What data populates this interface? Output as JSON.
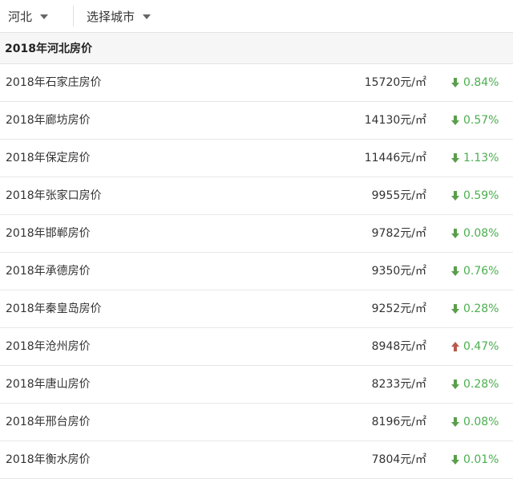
{
  "filters": {
    "province": "河北",
    "city_placeholder": "选择城市"
  },
  "section": {
    "title": "2018年河北房价"
  },
  "colors": {
    "down_arrow": "#5a9e4b",
    "up_arrow": "#b85a4a",
    "change_text": "#4caf50"
  },
  "rows": [
    {
      "name": "2018年石家庄房价",
      "price": "15720元/㎡",
      "direction": "down",
      "change": "0.84%"
    },
    {
      "name": "2018年廊坊房价",
      "price": "14130元/㎡",
      "direction": "down",
      "change": "0.57%"
    },
    {
      "name": "2018年保定房价",
      "price": "11446元/㎡",
      "direction": "down",
      "change": "1.13%"
    },
    {
      "name": "2018年张家口房价",
      "price": "9955元/㎡",
      "direction": "down",
      "change": "0.59%"
    },
    {
      "name": "2018年邯郸房价",
      "price": "9782元/㎡",
      "direction": "down",
      "change": "0.08%"
    },
    {
      "name": "2018年承德房价",
      "price": "9350元/㎡",
      "direction": "down",
      "change": "0.76%"
    },
    {
      "name": "2018年秦皇岛房价",
      "price": "9252元/㎡",
      "direction": "down",
      "change": "0.28%"
    },
    {
      "name": "2018年沧州房价",
      "price": "8948元/㎡",
      "direction": "up",
      "change": "0.47%"
    },
    {
      "name": "2018年唐山房价",
      "price": "8233元/㎡",
      "direction": "down",
      "change": "0.28%"
    },
    {
      "name": "2018年邢台房价",
      "price": "8196元/㎡",
      "direction": "down",
      "change": "0.08%"
    },
    {
      "name": "2018年衡水房价",
      "price": "7804元/㎡",
      "direction": "down",
      "change": "0.01%"
    }
  ]
}
